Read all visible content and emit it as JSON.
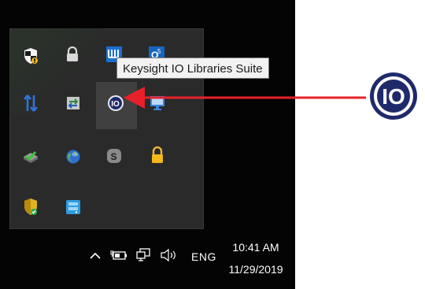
{
  "tooltip": {
    "text": "Keysight IO Libraries Suite"
  },
  "tray_overflow": {
    "icons": [
      {
        "name": "windows-security-shield-icon"
      },
      {
        "name": "lock-icon"
      },
      {
        "name": "keysight-icon"
      },
      {
        "name": "outlook-icon"
      },
      {
        "name": "sync-arrows-icon"
      },
      {
        "name": "network-adapter-icon"
      },
      {
        "name": "keysight-io-icon"
      },
      {
        "name": "remote-display-icon"
      },
      {
        "name": "checkmark-drive-icon"
      },
      {
        "name": "globe-icon"
      },
      {
        "name": "skype-icon"
      },
      {
        "name": "padlock-icon"
      },
      {
        "name": "shield-check-icon"
      },
      {
        "name": "server-icon"
      }
    ]
  },
  "taskbar": {
    "language": "ENG",
    "time": "10:41 AM",
    "date": "11/29/2019"
  },
  "callout": {
    "icon_label": "IO",
    "arrow_color": "#e8202a",
    "icon_color": "#1f2a6b"
  }
}
